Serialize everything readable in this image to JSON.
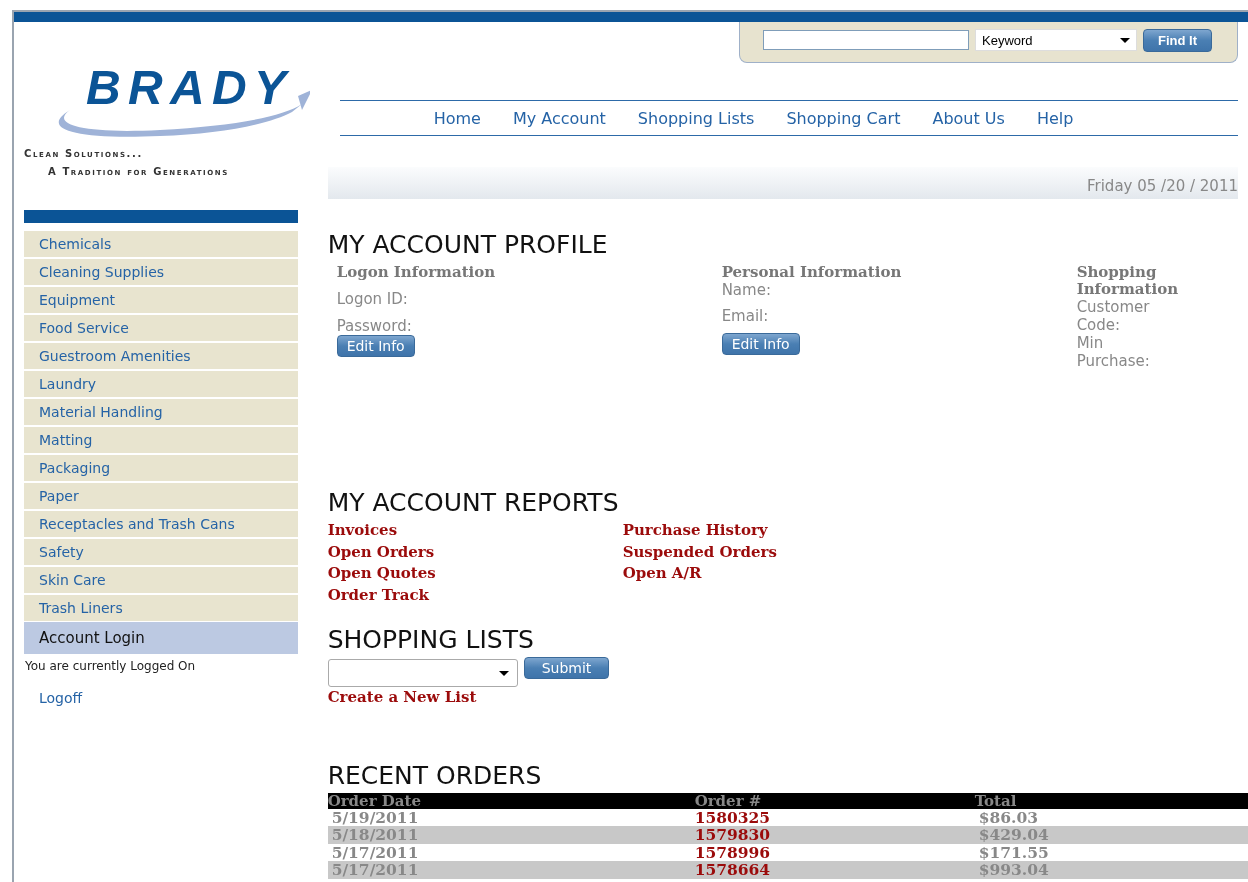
{
  "logo": {
    "name": "BRADY",
    "tagline_1": "Clean Solutions...",
    "tagline_2": "A Tradition for Generations"
  },
  "search": {
    "scope": "Keyword",
    "button": "Find It"
  },
  "nav": [
    "Home",
    "My Account",
    "Shopping Lists",
    "Shopping Cart",
    "About Us",
    "Help"
  ],
  "date": "Friday 05 /20 / 2011",
  "sidebar": {
    "categories": [
      "Chemicals",
      "Cleaning Supplies",
      "Equipment",
      "Food Service",
      "Guestroom Amenities",
      "Laundry",
      "Material Handling",
      "Matting",
      "Packaging",
      "Paper",
      "Receptacles and Trash Cans",
      "Safety",
      "Skin Care",
      "Trash Liners"
    ],
    "login_heading": "Account Login",
    "status": "You are currently Logged On",
    "logoff": "Logoff"
  },
  "profile": {
    "title": "MY ACCOUNT PROFILE",
    "sections": [
      {
        "heading": "Logon Information",
        "fields": [
          "Logon ID:",
          "Password:"
        ],
        "button": "Edit Info"
      },
      {
        "heading": "Personal Information",
        "fields": [
          "Name:",
          "Email:"
        ],
        "button": "Edit Info"
      },
      {
        "heading": "Shopping Information",
        "fields": [
          "Customer Code:",
          "Min Purchase:"
        ]
      }
    ]
  },
  "reports": {
    "title": "MY ACCOUNT REPORTS",
    "columns": [
      [
        "Invoices",
        "Open Orders",
        "Open Quotes",
        "Order Track"
      ],
      [
        "Purchase History",
        "Suspended Orders",
        "Open A/R"
      ]
    ]
  },
  "shopping_lists": {
    "title": "SHOPPING LISTS",
    "button": "Submit",
    "create_link": "Create a New List"
  },
  "recent_orders": {
    "title": "RECENT ORDERS",
    "columns": [
      "Order Date",
      "Order #",
      "Total"
    ],
    "rows": [
      {
        "date": "5/19/2011",
        "order": "1580325",
        "total": "$86.03"
      },
      {
        "date": "5/18/2011",
        "order": "1579830",
        "total": "$429.04"
      },
      {
        "date": "5/17/2011",
        "order": "1578996",
        "total": "$171.55"
      },
      {
        "date": "5/17/2011",
        "order": "1578664",
        "total": "$993.04"
      }
    ]
  }
}
